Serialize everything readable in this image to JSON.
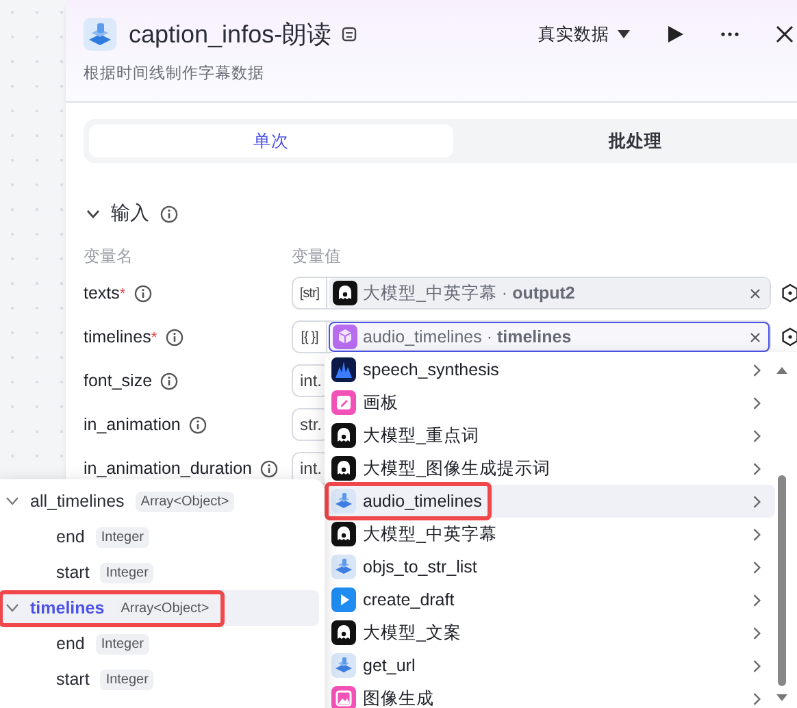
{
  "header": {
    "title": "caption_infos-朗读",
    "description": "根据时间线制作字幕数据",
    "data_mode": "真实数据"
  },
  "tabs": [
    {
      "label": "单次",
      "selected": true
    },
    {
      "label": "批处理",
      "selected": false
    }
  ],
  "input_section": {
    "title": "输入",
    "expanded": true,
    "columns": [
      "变量名",
      "变量值"
    ],
    "rows": [
      {
        "name": "texts",
        "required_mark": "*",
        "type": "[str]",
        "value": {
          "kind": "bot",
          "text": "大模型_中英字幕 · **output2**"
        },
        "focused": false
      },
      {
        "name": "timelines",
        "required_mark": "*",
        "type": "[{ }]",
        "value": {
          "kind": "cube",
          "text": "audio_timelines · **timelines**"
        },
        "focused": true
      },
      {
        "name": "font_size",
        "type": "int."
      },
      {
        "name": "in_animation",
        "type": "str."
      },
      {
        "name": "in_animation_duration",
        "type": "int."
      }
    ]
  },
  "node_menu": {
    "items": [
      {
        "label": "speech_synthesis",
        "kind": "waveform",
        "selected": false,
        "highlighted": false
      },
      {
        "label": "画板",
        "kind": "board",
        "selected": false,
        "highlighted": false
      },
      {
        "label": "大模型_重点词",
        "kind": "bot",
        "selected": false,
        "highlighted": false
      },
      {
        "label": "大模型_图像生成提示词",
        "kind": "bot",
        "selected": false,
        "highlighted": false
      },
      {
        "label": "audio_timelines",
        "kind": "plugin",
        "selected": true,
        "highlighted": true
      },
      {
        "label": "大模型_中英字幕",
        "kind": "bot",
        "selected": false,
        "highlighted": false
      },
      {
        "label": "objs_to_str_list",
        "kind": "plugin",
        "selected": false,
        "highlighted": false
      },
      {
        "label": "create_draft",
        "kind": "play",
        "selected": false,
        "highlighted": false
      },
      {
        "label": "大模型_文案",
        "kind": "bot",
        "selected": false,
        "highlighted": false
      },
      {
        "label": "get_url",
        "kind": "plugin",
        "selected": false,
        "highlighted": false
      },
      {
        "label": "图像生成",
        "kind": "image",
        "selected": false,
        "highlighted": false
      }
    ]
  },
  "output_tree": {
    "items": [
      {
        "name": "all_timelines",
        "type": "Array<Object>",
        "expanded": true,
        "selected": false,
        "highlighted": false,
        "children": [
          {
            "name": "end",
            "type": "Integer",
            "selected": false,
            "highlighted": false
          },
          {
            "name": "start",
            "type": "Integer",
            "selected": false,
            "highlighted": false
          }
        ]
      },
      {
        "name": "timelines",
        "type": "Array<Object>",
        "expanded": true,
        "selected": true,
        "highlighted": true,
        "children": [
          {
            "name": "end",
            "type": "Integer",
            "selected": false,
            "highlighted": false
          },
          {
            "name": "start",
            "type": "Integer",
            "selected": false,
            "highlighted": false
          }
        ]
      }
    ]
  }
}
